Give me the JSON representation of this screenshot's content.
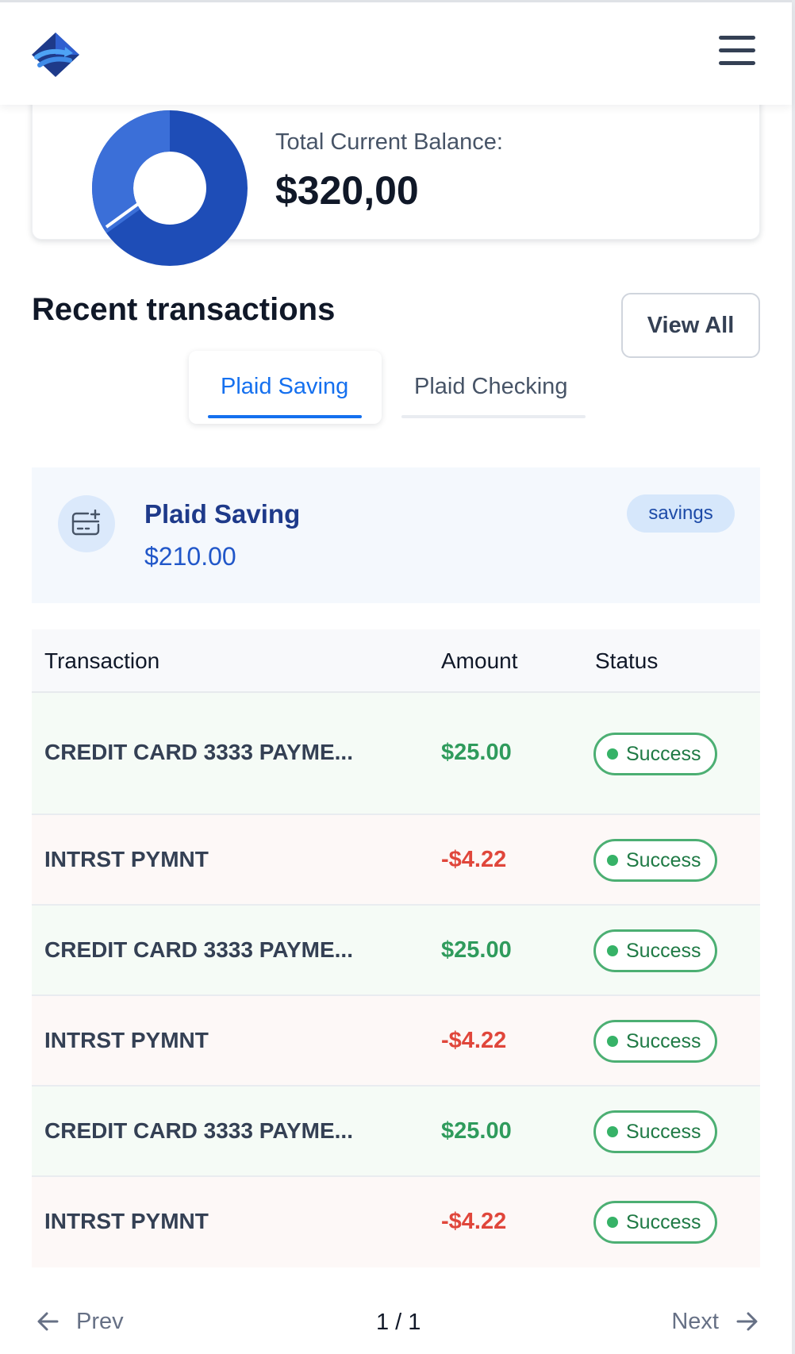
{
  "header": {
    "logo": "app-logo",
    "menu_icon": "hamburger-menu-icon"
  },
  "balance": {
    "label": "Total Current Balance:",
    "value": "$320,00",
    "chart_colors": [
      "#3b6fd8",
      "#1e4db7"
    ]
  },
  "transactions": {
    "title": "Recent transactions",
    "view_all": "View All",
    "tabs": [
      {
        "label": "Plaid Saving",
        "active": true
      },
      {
        "label": "Plaid Checking",
        "active": false
      }
    ],
    "account": {
      "name": "Plaid Saving",
      "balance": "$210.00",
      "badge": "savings",
      "icon": "credit-card-add-icon"
    },
    "table": {
      "headers": [
        "Transaction",
        "Amount",
        "Status"
      ],
      "rows": [
        {
          "name": "CREDIT CARD 3333 PAYME...",
          "amount": "$25.00",
          "status": "Success",
          "type": "credit"
        },
        {
          "name": "INTRST PYMNT",
          "amount": "-$4.22",
          "status": "Success",
          "type": "debit"
        },
        {
          "name": "CREDIT CARD 3333 PAYME...",
          "amount": "$25.00",
          "status": "Success",
          "type": "credit"
        },
        {
          "name": "INTRST PYMNT",
          "amount": "-$4.22",
          "status": "Success",
          "type": "debit"
        },
        {
          "name": "CREDIT CARD 3333 PAYME...",
          "amount": "$25.00",
          "status": "Success",
          "type": "credit"
        },
        {
          "name": "INTRST PYMNT",
          "amount": "-$4.22",
          "status": "Success",
          "type": "debit"
        }
      ]
    },
    "pagination": {
      "prev": "Prev",
      "next": "Next",
      "page": "1 / 1"
    }
  },
  "colors": {
    "primary": "#1570ef",
    "credit": "#2f9b5c",
    "debit": "#e0463b",
    "success_border": "#4caf73"
  }
}
